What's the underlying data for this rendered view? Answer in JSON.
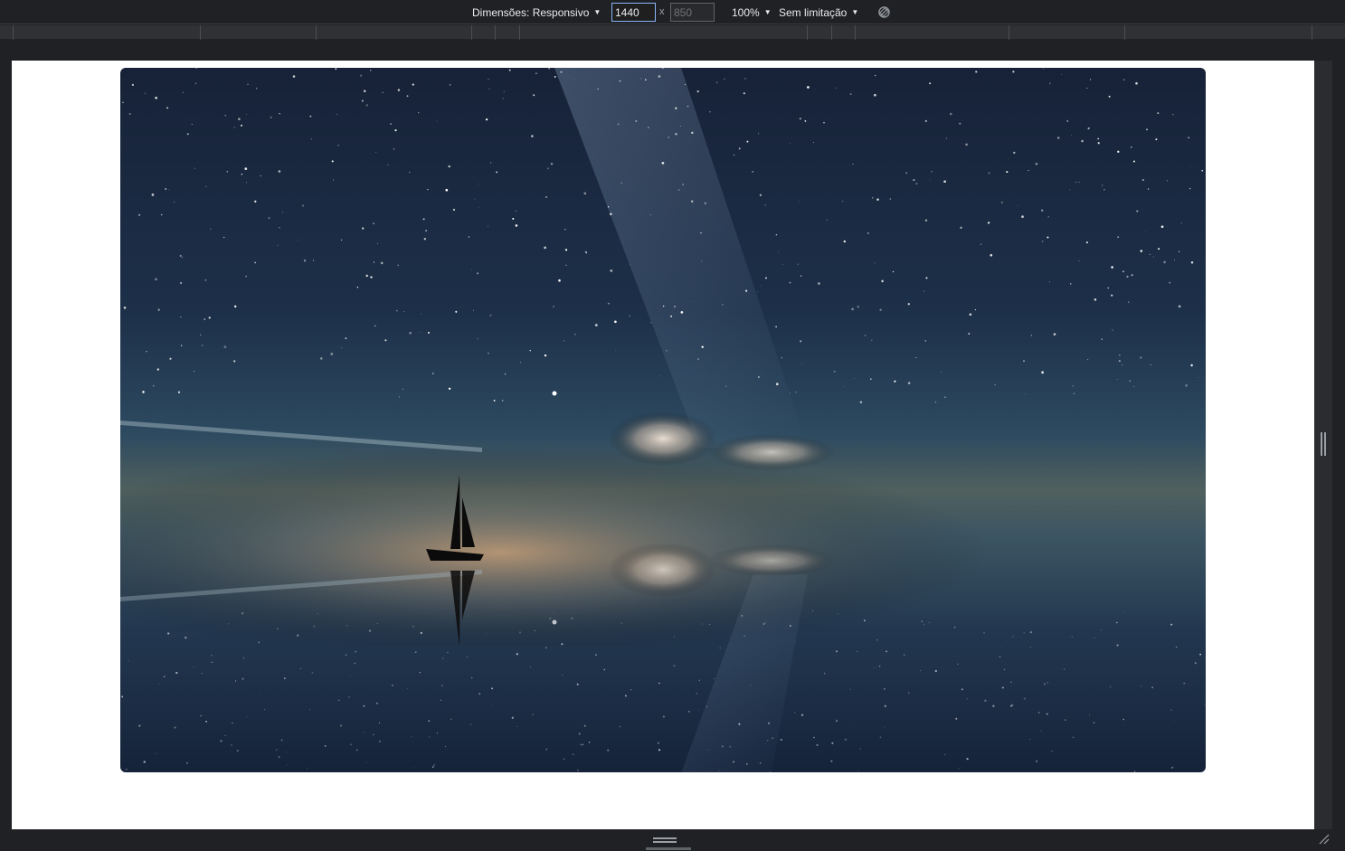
{
  "toolbar": {
    "dimensions_label": "Dimensões: Responsivo",
    "width_value": "1440",
    "times_symbol": "x",
    "height_placeholder": "850",
    "zoom_label": "100%",
    "throttle_label": "Sem limitação",
    "rotate_icon": "rotate-icon"
  },
  "colors": {
    "toolbar_bg": "#202124",
    "ruler_bg": "#2f3135",
    "page_bg": "#ffffff",
    "input_focus_border": "#8ab4f8"
  },
  "page": {
    "image_icon": "night-sky-sailboat-photo"
  }
}
